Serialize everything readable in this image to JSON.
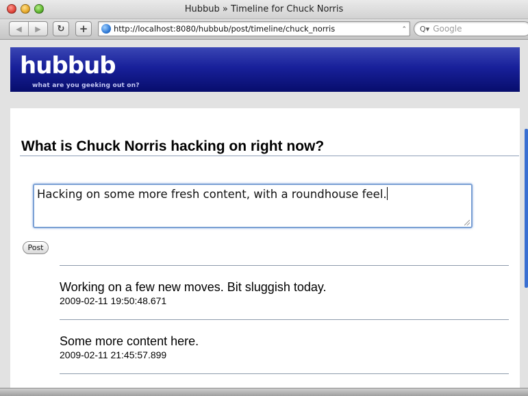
{
  "window": {
    "title": "Hubbub » Timeline for Chuck Norris"
  },
  "toolbar": {
    "back_icon": "◀",
    "forward_icon": "▶",
    "reload_icon": "↻",
    "add_bookmark_icon": "+",
    "url": "http://localhost:8080/hubbub/post/timeline/chuck_norris",
    "search_placeholder": "Google"
  },
  "site": {
    "logo": "hubbub",
    "tagline": "what are you geeking out on?",
    "brand_color": "#18209a"
  },
  "main": {
    "heading": "What is Chuck Norris hacking on right now?",
    "status_value": "Hacking on some more fresh content, with a roundhouse feel.",
    "post_label": "Post"
  },
  "posts": [
    {
      "content": "Working on a few new moves. Bit sluggish today.",
      "date": "2009-02-11 19:50:48.671"
    },
    {
      "content": "Some more content here.",
      "date": "2009-02-11 21:45:57.899"
    }
  ]
}
